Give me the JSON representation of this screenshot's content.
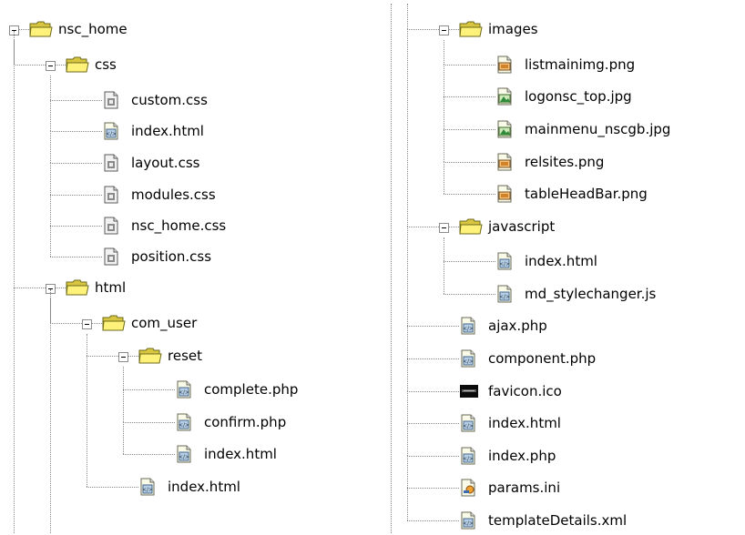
{
  "tree": {
    "left": [
      {
        "label": "nsc_home",
        "type": "folder"
      },
      {
        "label": "css",
        "type": "folder"
      },
      {
        "label": "custom.css",
        "type": "css-file"
      },
      {
        "label": "index.html",
        "type": "html-file"
      },
      {
        "label": "layout.css",
        "type": "css-file"
      },
      {
        "label": "modules.css",
        "type": "css-file"
      },
      {
        "label": "nsc_home.css",
        "type": "css-file"
      },
      {
        "label": "position.css",
        "type": "css-file"
      },
      {
        "label": "html",
        "type": "folder"
      },
      {
        "label": "com_user",
        "type": "folder"
      },
      {
        "label": "reset",
        "type": "folder"
      },
      {
        "label": "complete.php",
        "type": "php-file"
      },
      {
        "label": "confirm.php",
        "type": "php-file"
      },
      {
        "label": "index.html",
        "type": "html-file"
      },
      {
        "label": "index.html",
        "type": "html-file"
      }
    ],
    "right": [
      {
        "label": "images",
        "type": "folder"
      },
      {
        "label": "listmainimg.png",
        "type": "image-file"
      },
      {
        "label": "logonsc_top.jpg",
        "type": "jpg-file"
      },
      {
        "label": "mainmenu_nscgb.jpg",
        "type": "jpg-file"
      },
      {
        "label": "relsites.png",
        "type": "image-file"
      },
      {
        "label": "tableHeadBar.png",
        "type": "image-file"
      },
      {
        "label": "javascript",
        "type": "folder"
      },
      {
        "label": "index.html",
        "type": "html-file"
      },
      {
        "label": "md_stylechanger.js",
        "type": "html-file"
      },
      {
        "label": "ajax.php",
        "type": "php-file"
      },
      {
        "label": "component.php",
        "type": "php-file"
      },
      {
        "label": "favicon.ico",
        "type": "ico-file"
      },
      {
        "label": "index.html",
        "type": "html-file"
      },
      {
        "label": "index.php",
        "type": "php-file"
      },
      {
        "label": "params.ini",
        "type": "ini-file"
      },
      {
        "label": "templateDetails.xml",
        "type": "html-file"
      }
    ]
  }
}
